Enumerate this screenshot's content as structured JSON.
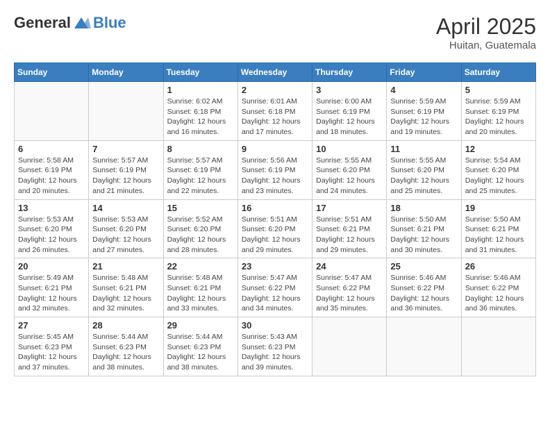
{
  "header": {
    "logo_general": "General",
    "logo_blue": "Blue",
    "month_title": "April 2025",
    "location": "Huitan, Guatemala"
  },
  "weekdays": [
    "Sunday",
    "Monday",
    "Tuesday",
    "Wednesday",
    "Thursday",
    "Friday",
    "Saturday"
  ],
  "weeks": [
    [
      {
        "day": "",
        "info": ""
      },
      {
        "day": "",
        "info": ""
      },
      {
        "day": "1",
        "info": "Sunrise: 6:02 AM\nSunset: 6:18 PM\nDaylight: 12 hours and 16 minutes."
      },
      {
        "day": "2",
        "info": "Sunrise: 6:01 AM\nSunset: 6:18 PM\nDaylight: 12 hours and 17 minutes."
      },
      {
        "day": "3",
        "info": "Sunrise: 6:00 AM\nSunset: 6:19 PM\nDaylight: 12 hours and 18 minutes."
      },
      {
        "day": "4",
        "info": "Sunrise: 5:59 AM\nSunset: 6:19 PM\nDaylight: 12 hours and 19 minutes."
      },
      {
        "day": "5",
        "info": "Sunrise: 5:59 AM\nSunset: 6:19 PM\nDaylight: 12 hours and 20 minutes."
      }
    ],
    [
      {
        "day": "6",
        "info": "Sunrise: 5:58 AM\nSunset: 6:19 PM\nDaylight: 12 hours and 20 minutes."
      },
      {
        "day": "7",
        "info": "Sunrise: 5:57 AM\nSunset: 6:19 PM\nDaylight: 12 hours and 21 minutes."
      },
      {
        "day": "8",
        "info": "Sunrise: 5:57 AM\nSunset: 6:19 PM\nDaylight: 12 hours and 22 minutes."
      },
      {
        "day": "9",
        "info": "Sunrise: 5:56 AM\nSunset: 6:19 PM\nDaylight: 12 hours and 23 minutes."
      },
      {
        "day": "10",
        "info": "Sunrise: 5:55 AM\nSunset: 6:20 PM\nDaylight: 12 hours and 24 minutes."
      },
      {
        "day": "11",
        "info": "Sunrise: 5:55 AM\nSunset: 6:20 PM\nDaylight: 12 hours and 25 minutes."
      },
      {
        "day": "12",
        "info": "Sunrise: 5:54 AM\nSunset: 6:20 PM\nDaylight: 12 hours and 25 minutes."
      }
    ],
    [
      {
        "day": "13",
        "info": "Sunrise: 5:53 AM\nSunset: 6:20 PM\nDaylight: 12 hours and 26 minutes."
      },
      {
        "day": "14",
        "info": "Sunrise: 5:53 AM\nSunset: 6:20 PM\nDaylight: 12 hours and 27 minutes."
      },
      {
        "day": "15",
        "info": "Sunrise: 5:52 AM\nSunset: 6:20 PM\nDaylight: 12 hours and 28 minutes."
      },
      {
        "day": "16",
        "info": "Sunrise: 5:51 AM\nSunset: 6:20 PM\nDaylight: 12 hours and 29 minutes."
      },
      {
        "day": "17",
        "info": "Sunrise: 5:51 AM\nSunset: 6:21 PM\nDaylight: 12 hours and 29 minutes."
      },
      {
        "day": "18",
        "info": "Sunrise: 5:50 AM\nSunset: 6:21 PM\nDaylight: 12 hours and 30 minutes."
      },
      {
        "day": "19",
        "info": "Sunrise: 5:50 AM\nSunset: 6:21 PM\nDaylight: 12 hours and 31 minutes."
      }
    ],
    [
      {
        "day": "20",
        "info": "Sunrise: 5:49 AM\nSunset: 6:21 PM\nDaylight: 12 hours and 32 minutes."
      },
      {
        "day": "21",
        "info": "Sunrise: 5:48 AM\nSunset: 6:21 PM\nDaylight: 12 hours and 32 minutes."
      },
      {
        "day": "22",
        "info": "Sunrise: 5:48 AM\nSunset: 6:21 PM\nDaylight: 12 hours and 33 minutes."
      },
      {
        "day": "23",
        "info": "Sunrise: 5:47 AM\nSunset: 6:22 PM\nDaylight: 12 hours and 34 minutes."
      },
      {
        "day": "24",
        "info": "Sunrise: 5:47 AM\nSunset: 6:22 PM\nDaylight: 12 hours and 35 minutes."
      },
      {
        "day": "25",
        "info": "Sunrise: 5:46 AM\nSunset: 6:22 PM\nDaylight: 12 hours and 36 minutes."
      },
      {
        "day": "26",
        "info": "Sunrise: 5:46 AM\nSunset: 6:22 PM\nDaylight: 12 hours and 36 minutes."
      }
    ],
    [
      {
        "day": "27",
        "info": "Sunrise: 5:45 AM\nSunset: 6:23 PM\nDaylight: 12 hours and 37 minutes."
      },
      {
        "day": "28",
        "info": "Sunrise: 5:44 AM\nSunset: 6:23 PM\nDaylight: 12 hours and 38 minutes."
      },
      {
        "day": "29",
        "info": "Sunrise: 5:44 AM\nSunset: 6:23 PM\nDaylight: 12 hours and 38 minutes."
      },
      {
        "day": "30",
        "info": "Sunrise: 5:43 AM\nSunset: 6:23 PM\nDaylight: 12 hours and 39 minutes."
      },
      {
        "day": "",
        "info": ""
      },
      {
        "day": "",
        "info": ""
      },
      {
        "day": "",
        "info": ""
      }
    ]
  ]
}
